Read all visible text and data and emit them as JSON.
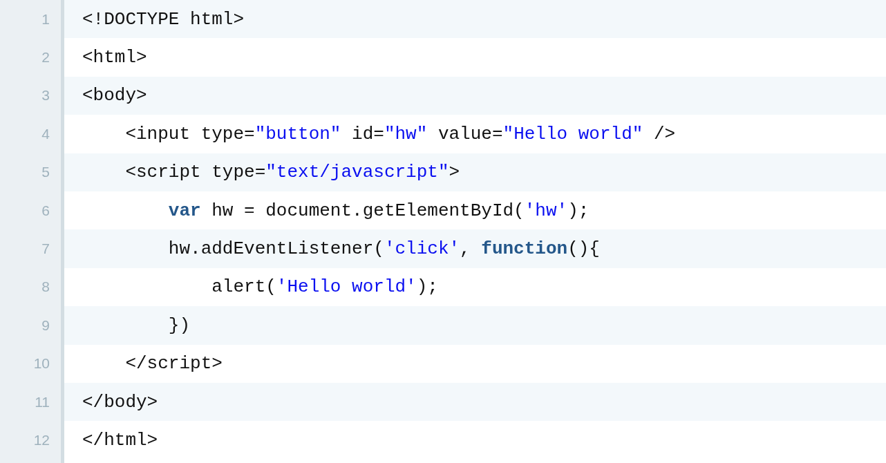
{
  "code_lines": [
    {
      "number": "1",
      "tokens": [
        {
          "text": "<!DOCTYPE html>",
          "kind": "plain"
        }
      ]
    },
    {
      "number": "2",
      "tokens": [
        {
          "text": "<html>",
          "kind": "plain"
        }
      ]
    },
    {
      "number": "3",
      "tokens": [
        {
          "text": "<body>",
          "kind": "plain"
        }
      ]
    },
    {
      "number": "4",
      "tokens": [
        {
          "text": "    <input type=",
          "kind": "plain"
        },
        {
          "text": "\"button\"",
          "kind": "string"
        },
        {
          "text": " id=",
          "kind": "plain"
        },
        {
          "text": "\"hw\"",
          "kind": "string"
        },
        {
          "text": " value=",
          "kind": "plain"
        },
        {
          "text": "\"Hello world\"",
          "kind": "string"
        },
        {
          "text": " />",
          "kind": "plain"
        }
      ]
    },
    {
      "number": "5",
      "tokens": [
        {
          "text": "    <script type=",
          "kind": "plain"
        },
        {
          "text": "\"text/javascript\"",
          "kind": "string"
        },
        {
          "text": ">",
          "kind": "plain"
        }
      ]
    },
    {
      "number": "6",
      "tokens": [
        {
          "text": "        var",
          "kind": "keyword"
        },
        {
          "text": " hw = document.getElementById(",
          "kind": "plain"
        },
        {
          "text": "'hw'",
          "kind": "string"
        },
        {
          "text": ");",
          "kind": "plain"
        }
      ]
    },
    {
      "number": "7",
      "tokens": [
        {
          "text": "        hw.addEventListener(",
          "kind": "plain"
        },
        {
          "text": "'click'",
          "kind": "string"
        },
        {
          "text": ", ",
          "kind": "plain"
        },
        {
          "text": "function",
          "kind": "keyword"
        },
        {
          "text": "(){",
          "kind": "plain"
        }
      ]
    },
    {
      "number": "8",
      "tokens": [
        {
          "text": "            alert(",
          "kind": "plain"
        },
        {
          "text": "'Hello world'",
          "kind": "string"
        },
        {
          "text": ");",
          "kind": "plain"
        }
      ]
    },
    {
      "number": "9",
      "tokens": [
        {
          "text": "        })",
          "kind": "plain"
        }
      ]
    },
    {
      "number": "10",
      "tokens": [
        {
          "text": "    </script>",
          "kind": "plain"
        }
      ]
    },
    {
      "number": "11",
      "tokens": [
        {
          "text": "</body>",
          "kind": "plain"
        }
      ]
    },
    {
      "number": "12",
      "tokens": [
        {
          "text": "</html>",
          "kind": "plain"
        }
      ]
    }
  ]
}
